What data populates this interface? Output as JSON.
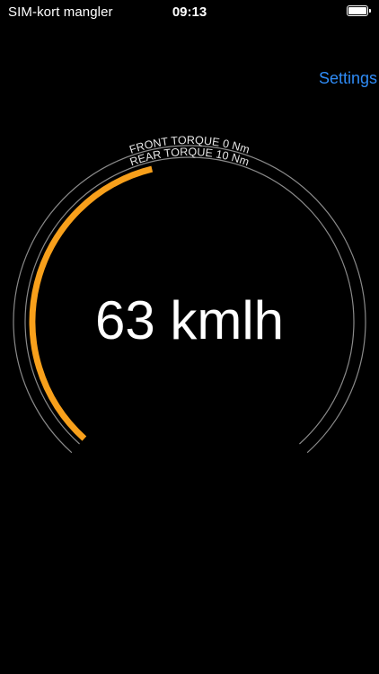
{
  "status_bar": {
    "carrier": "SIM-kort mangler",
    "time": "09:13",
    "battery_level": 1.0
  },
  "nav": {
    "settings_label": "Settings"
  },
  "gauge": {
    "speed_text": "63 kmlh",
    "front_torque_label": "FRONT TORQUE 0 Nm",
    "rear_torque_label": "REAR TORQUE 10 Nm",
    "progress_fraction": 0.45
  },
  "colors": {
    "background": "#000000",
    "accent": "#f8a01b",
    "link": "#2f8cf7",
    "track": "#8a8a8a"
  }
}
